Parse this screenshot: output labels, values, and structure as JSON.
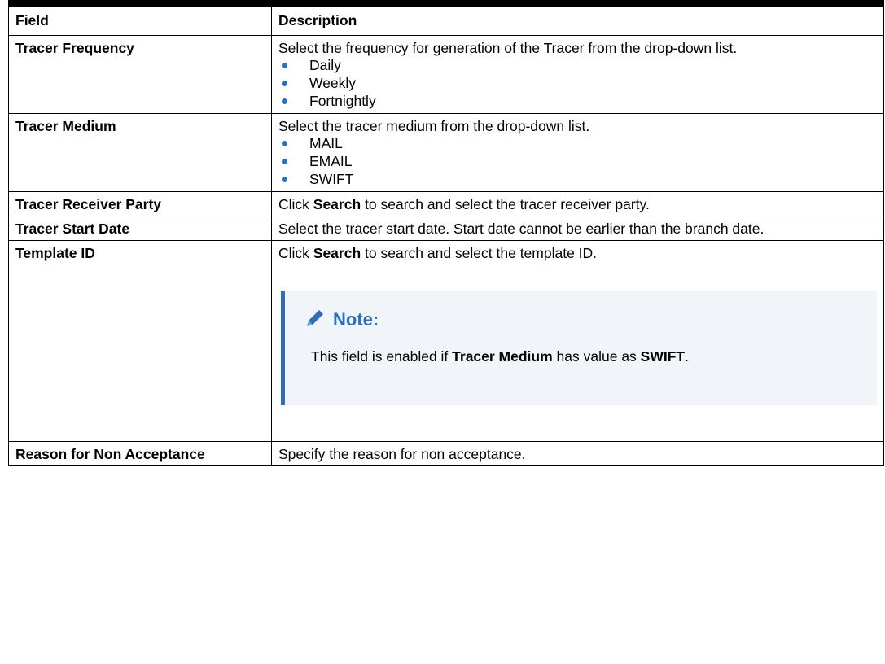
{
  "header": {
    "field": "Field",
    "description": "Description"
  },
  "rows": {
    "tracer_frequency": {
      "field": "Tracer Frequency",
      "description": "Select the frequency for generation of the Tracer from the drop-down list.",
      "options": [
        "Daily",
        "Weekly",
        "Fortnightly"
      ]
    },
    "tracer_medium": {
      "field": "Tracer Medium",
      "description": "Select the tracer medium from the drop-down list.",
      "options": [
        "MAIL",
        "EMAIL",
        "SWIFT"
      ]
    },
    "tracer_receiver_party": {
      "field": "Tracer Receiver Party",
      "pre": "Click ",
      "bold": "Search",
      "post": " to search and select the tracer receiver party."
    },
    "tracer_start_date": {
      "field": "Tracer Start Date",
      "description": "Select the tracer start date. Start date cannot be earlier than the branch date."
    },
    "template_id": {
      "field": "Template ID",
      "pre": "Click ",
      "bold": "Search",
      "post": " to search and select the template ID.",
      "note": {
        "title": "Note:",
        "pre": "This field is enabled if ",
        "bold1": "Tracer Medium",
        "mid": " has value as ",
        "bold2": "SWIFT",
        "post": "."
      }
    },
    "reason_for_non_acceptance": {
      "field": "Reason for Non Acceptance",
      "description": "Specify the reason for non acceptance."
    }
  },
  "colors": {
    "accent": "#2f6fb7",
    "note_bg": "#f1f5fa"
  },
  "icons": {
    "note": "pencil-icon"
  }
}
